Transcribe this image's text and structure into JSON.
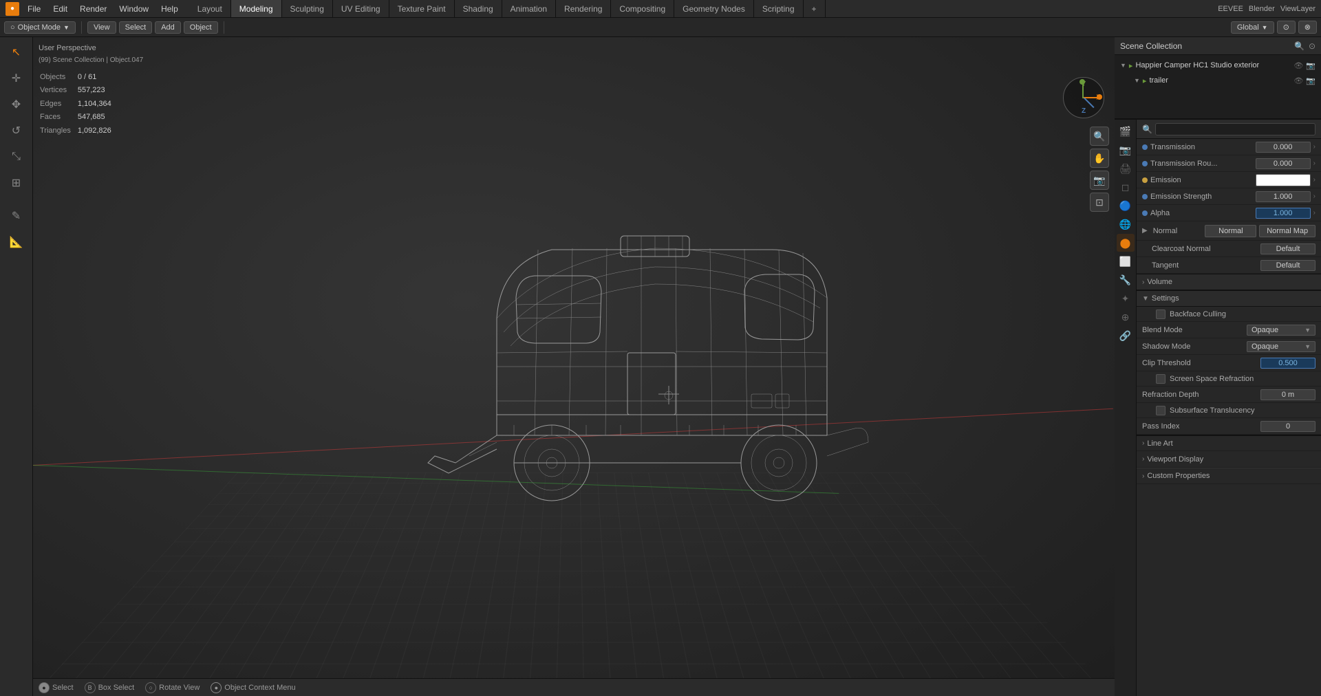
{
  "app": {
    "title": "Blender",
    "engine": "EEVEE"
  },
  "top_menu": {
    "items": [
      "File",
      "Edit",
      "Render",
      "Window",
      "Help"
    ]
  },
  "workspace_tabs": [
    {
      "label": "Layout"
    },
    {
      "label": "Modeling",
      "active": true
    },
    {
      "label": "Sculpting"
    },
    {
      "label": "UV Editing"
    },
    {
      "label": "Texture Paint"
    },
    {
      "label": "Shading"
    },
    {
      "label": "Animation"
    },
    {
      "label": "Rendering"
    },
    {
      "label": "Compositing"
    },
    {
      "label": "Geometry Nodes"
    },
    {
      "label": "Scripting"
    },
    {
      "label": "+"
    }
  ],
  "second_toolbar": {
    "mode": "Object Mode",
    "global": "Global",
    "select": "Select",
    "add": "Add",
    "object": "Object"
  },
  "viewport": {
    "view_type": "User Perspective",
    "scene_info": "(99) Scene Collection | Object.047",
    "stats": {
      "objects": {
        "label": "Objects",
        "value": "0 / 61"
      },
      "vertices": {
        "label": "Vertices",
        "value": "557,223"
      },
      "edges": {
        "label": "Edges",
        "value": "1,104,364"
      },
      "faces": {
        "label": "Faces",
        "value": "547,685"
      },
      "triangles": {
        "label": "Triangles",
        "value": "1,092,826"
      }
    }
  },
  "outliner": {
    "title": "Scene Collection",
    "items": [
      {
        "label": "Happier Camper HC1 Studio exterior",
        "icon": "collection",
        "indent": 1
      },
      {
        "label": "trailer",
        "icon": "collection",
        "indent": 2
      }
    ]
  },
  "properties": {
    "search_placeholder": "",
    "rows": [
      {
        "label": "Transmission",
        "dot": "blue",
        "value": "0.000"
      },
      {
        "label": "Transmission Rou...",
        "dot": "blue",
        "value": "0.000"
      },
      {
        "label": "Emission",
        "dot": "yellow",
        "value": "",
        "type": "color"
      },
      {
        "label": "Emission Strength",
        "dot": "blue",
        "value": "1.000"
      },
      {
        "label": "Alpha",
        "dot": "blue",
        "value": "1.000",
        "highlight": true
      },
      {
        "label": "Normal",
        "left_val": "Normal",
        "right_val": "Normal Map",
        "type": "normal"
      },
      {
        "label": "Clearcoat Normal",
        "value": "Default"
      },
      {
        "label": "Tangent",
        "value": "Default"
      }
    ],
    "sections": {
      "volume": "Volume",
      "settings": "Settings"
    },
    "settings": {
      "backface_culling": {
        "label": "Backface Culling",
        "checked": false
      },
      "blend_mode": {
        "label": "Blend Mode",
        "value": "Opaque"
      },
      "shadow_mode": {
        "label": "Shadow Mode",
        "value": "Opaque"
      },
      "clip_threshold": {
        "label": "Clip Threshold",
        "value": "0.500"
      },
      "screen_space_refraction": {
        "label": "Screen Space Refraction",
        "checked": false
      },
      "refraction_depth": {
        "label": "Refraction Depth",
        "value": "0 m"
      },
      "subsurface_translucency": {
        "label": "Subsurface Translucency",
        "checked": false
      },
      "pass_index": {
        "label": "Pass Index",
        "value": "0"
      }
    },
    "extra_sections": {
      "line_art": "Line Art",
      "viewport_display": "Viewport Display",
      "custom_properties": "Custom Properties"
    }
  },
  "status_bar": {
    "select": "Select",
    "box_select": "Box Select",
    "rotate_view": "Rotate View",
    "context_menu": "Object Context Menu"
  }
}
